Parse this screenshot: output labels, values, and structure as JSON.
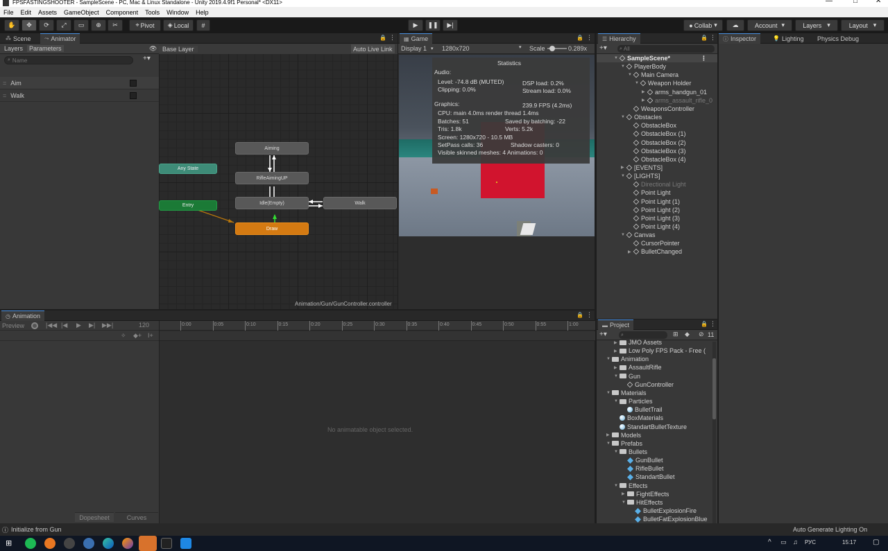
{
  "window": {
    "title": "FPSFASTINGSHOOTER - SampleScene - PC, Mac & Linux Standalone - Unity 2019.4.9f1 Personal* <DX11>",
    "min": "—",
    "max": "□",
    "close": "✕"
  },
  "menu": [
    "File",
    "Edit",
    "Assets",
    "GameObject",
    "Component",
    "Tools",
    "Window",
    "Help"
  ],
  "toolbar": {
    "pivot": "Pivot",
    "local": "Local",
    "collab": "Collab",
    "account": "Account",
    "layers": "Layers",
    "layout": "Layout"
  },
  "animator": {
    "tab_scene": "Scene",
    "tab_animator": "Animator",
    "sub_layers": "Layers",
    "sub_parameters": "Parameters",
    "search_placeholder": "Name",
    "base_layer": "Base Layer",
    "auto_live_link": "Auto Live Link",
    "footer_path": "Animation/Gun/GunController.controller",
    "parameters": [
      {
        "name": "Aim"
      },
      {
        "name": "Walk"
      }
    ],
    "states": {
      "aiming": "Aiming",
      "rifle_up": "RifleAimingUP",
      "idle": "Idle(Empty)",
      "walk": "Walk",
      "draw": "Draw",
      "any": "Any State",
      "entry": "Entry"
    }
  },
  "game": {
    "tab": "Game",
    "display": "Display 1",
    "resolution": "1280x720",
    "scale_label": "Scale",
    "scale_value": "0.289x",
    "stats": {
      "title": "Statistics",
      "audio": "Audio:",
      "level": "Level: -74.8 dB (MUTED)",
      "clipping": "Clipping: 0.0%",
      "dsp": "DSP load: 0.2%",
      "stream": "Stream load: 0.0%",
      "graphics": "Graphics:",
      "fps": "239.9 FPS (4.2ms)",
      "cpu": "CPU: main 4.0ms  render thread 1.4ms",
      "batches": "Batches: 51",
      "saved": "Saved by batching: -22",
      "tris": "Tris: 1.8k",
      "verts": "Verts: 5.2k",
      "screen": "Screen: 1280x720 - 10.5 MB",
      "setpass": "SetPass calls: 36",
      "shadow": "Shadow casters: 0",
      "skinned": "Visible skinned meshes: 4  Animations: 0"
    }
  },
  "hierarchy": {
    "tab": "Hierarchy",
    "search_placeholder": "All",
    "items": [
      {
        "label": "SampleScene*",
        "depth": 0,
        "type": "scene",
        "arrow": "▼"
      },
      {
        "label": "PlayerBody",
        "depth": 1,
        "type": "cube",
        "arrow": "▼"
      },
      {
        "label": "Main Camera",
        "depth": 2,
        "type": "cube",
        "arrow": "▼"
      },
      {
        "label": "Weapon Holder",
        "depth": 3,
        "type": "cube",
        "arrow": "▼"
      },
      {
        "label": "arms_handgun_01",
        "depth": 4,
        "type": "cube",
        "arrow": "▶"
      },
      {
        "label": "arms_assault_rifle_0",
        "depth": 4,
        "type": "cube",
        "arrow": "▶",
        "dim": true
      },
      {
        "label": "WeaponsController",
        "depth": 2,
        "type": "cube",
        "arrow": ""
      },
      {
        "label": "Obstacles",
        "depth": 1,
        "type": "cube",
        "arrow": "▼"
      },
      {
        "label": "ObstacleBox",
        "depth": 2,
        "type": "cube",
        "arrow": ""
      },
      {
        "label": "ObstacleBox (1)",
        "depth": 2,
        "type": "cube",
        "arrow": ""
      },
      {
        "label": "ObstacleBox (2)",
        "depth": 2,
        "type": "cube",
        "arrow": ""
      },
      {
        "label": "ObstacleBox (3)",
        "depth": 2,
        "type": "cube",
        "arrow": ""
      },
      {
        "label": "ObstacleBox (4)",
        "depth": 2,
        "type": "cube",
        "arrow": ""
      },
      {
        "label": "[EVENTS]",
        "depth": 1,
        "type": "cube",
        "arrow": "▶"
      },
      {
        "label": "[LIGHTS]",
        "depth": 1,
        "type": "cube",
        "arrow": "▼"
      },
      {
        "label": "Directional Light",
        "depth": 2,
        "type": "cube",
        "arrow": "",
        "dim": true
      },
      {
        "label": "Point Light",
        "depth": 2,
        "type": "cube",
        "arrow": ""
      },
      {
        "label": "Point Light (1)",
        "depth": 2,
        "type": "cube",
        "arrow": ""
      },
      {
        "label": "Point Light (2)",
        "depth": 2,
        "type": "cube",
        "arrow": ""
      },
      {
        "label": "Point Light (3)",
        "depth": 2,
        "type": "cube",
        "arrow": ""
      },
      {
        "label": "Point Light (4)",
        "depth": 2,
        "type": "cube",
        "arrow": ""
      },
      {
        "label": "Canvas",
        "depth": 1,
        "type": "cube",
        "arrow": "▼"
      },
      {
        "label": "CursorPointer",
        "depth": 2,
        "type": "cube",
        "arrow": ""
      },
      {
        "label": "BulletChanged",
        "depth": 2,
        "type": "cube",
        "arrow": "▶"
      }
    ]
  },
  "inspector": {
    "tab_inspector": "Inspector",
    "tab_lighting": "Lighting",
    "tab_physics": "Physics Debug"
  },
  "animation": {
    "tab": "Animation",
    "preview": "Preview",
    "frame": "120",
    "ticks": [
      "0:00",
      "0:05",
      "0:10",
      "0:15",
      "0:20",
      "0:25",
      "0:30",
      "0:35",
      "0:40",
      "0:45",
      "0:50",
      "0:55",
      "1:00"
    ],
    "empty_message": "No animatable object selected.",
    "dopesheet": "Dopesheet",
    "curves": "Curves"
  },
  "project": {
    "tab": "Project",
    "badge": "11",
    "items": [
      {
        "label": "JMO Assets",
        "depth": 1,
        "type": "folder",
        "arrow": "▶"
      },
      {
        "label": "Low Poly FPS Pack - Free (",
        "depth": 1,
        "type": "folder",
        "arrow": "▶"
      },
      {
        "label": "Animation",
        "depth": 0,
        "type": "folder",
        "arrow": "▼"
      },
      {
        "label": "AssaultRifle",
        "depth": 1,
        "type": "folder",
        "arrow": "▶"
      },
      {
        "label": "Gun",
        "depth": 1,
        "type": "folder",
        "arrow": "▼"
      },
      {
        "label": "GunController",
        "depth": 2,
        "type": "controller",
        "arrow": ""
      },
      {
        "label": "Materials",
        "depth": 0,
        "type": "folder",
        "arrow": "▼"
      },
      {
        "label": "Particles",
        "depth": 1,
        "type": "folder",
        "arrow": "▼"
      },
      {
        "label": "BulletTrail",
        "depth": 2,
        "type": "mat",
        "arrow": ""
      },
      {
        "label": "BoxMaterials",
        "depth": 1,
        "type": "mat",
        "arrow": ""
      },
      {
        "label": "StandartBulletTexture",
        "depth": 1,
        "type": "mat",
        "arrow": ""
      },
      {
        "label": "Models",
        "depth": 0,
        "type": "folder",
        "arrow": "▶"
      },
      {
        "label": "Prefabs",
        "depth": 0,
        "type": "folder",
        "arrow": "▼"
      },
      {
        "label": "Bullets",
        "depth": 1,
        "type": "folder",
        "arrow": "▼"
      },
      {
        "label": "GunBullet",
        "depth": 2,
        "type": "prefab",
        "arrow": ""
      },
      {
        "label": "RifleBullet",
        "depth": 2,
        "type": "prefab",
        "arrow": ""
      },
      {
        "label": "StandartBullet",
        "depth": 2,
        "type": "prefab",
        "arrow": ""
      },
      {
        "label": "Effects",
        "depth": 1,
        "type": "folder",
        "arrow": "▼"
      },
      {
        "label": "FightEffects",
        "depth": 2,
        "type": "folder",
        "arrow": "▶"
      },
      {
        "label": "HitEffects",
        "depth": 2,
        "type": "folder",
        "arrow": "▼"
      },
      {
        "label": "BulletExplosionFire",
        "depth": 3,
        "type": "prefab",
        "arrow": ""
      },
      {
        "label": "BulletFatExplosionBlue",
        "depth": 3,
        "type": "prefab",
        "arrow": ""
      }
    ]
  },
  "status": {
    "message": "Initialize from Gun",
    "right": "Auto Generate Lighting On"
  },
  "taskbar": {
    "lang": "РУС",
    "time": "15:17"
  }
}
